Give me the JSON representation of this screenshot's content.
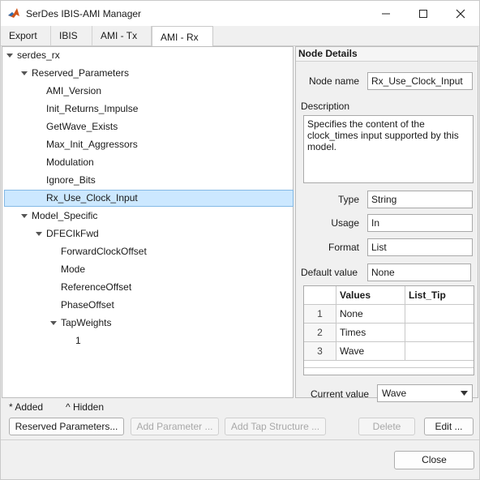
{
  "window": {
    "title": "SerDes IBIS-AMI Manager"
  },
  "tabs": [
    {
      "label": "Export"
    },
    {
      "label": "IBIS"
    },
    {
      "label": "AMI - Tx"
    },
    {
      "label": "AMI - Rx",
      "selected": true
    }
  ],
  "tree": {
    "root": "serdes_rx",
    "reserved": {
      "label": "Reserved_Parameters",
      "items": [
        "AMI_Version",
        "Init_Returns_Impulse",
        "GetWave_Exists",
        "Max_Init_Aggressors",
        "Modulation",
        "Ignore_Bits",
        "Rx_Use_Clock_Input"
      ]
    },
    "model_specific": {
      "label": "Model_Specific",
      "block": "DFECIkFwd",
      "params": [
        "ForwardClockOffset",
        "Mode",
        "ReferenceOffset",
        "PhaseOffset"
      ],
      "tapweights": "TapWeights",
      "tap_child": "1"
    },
    "selected_item": "Rx_Use_Clock_Input"
  },
  "details": {
    "header": "Node Details",
    "node_name_label": "Node name",
    "node_name": "Rx_Use_Clock_Input",
    "description_label": "Description",
    "description": "Specifies the content of the clock_times input supported by this model.",
    "type_label": "Type",
    "type": "String",
    "usage_label": "Usage",
    "usage": "In",
    "format_label": "Format",
    "format": "List",
    "default_label": "Default value",
    "default_value": "None",
    "table": {
      "columns": [
        "Values",
        "List_Tip"
      ],
      "rows": [
        {
          "num": "1",
          "value": "None",
          "tip": ""
        },
        {
          "num": "2",
          "value": "Times",
          "tip": ""
        },
        {
          "num": "3",
          "value": "Wave",
          "tip": ""
        }
      ]
    },
    "current_value_label": "Current value",
    "current_value": "Wave"
  },
  "legend": {
    "added": "* Added",
    "hidden": "^ Hidden"
  },
  "buttons": {
    "reserved_params": "Reserved Parameters...",
    "add_parameter": "Add Parameter ...",
    "add_tap": "Add Tap Structure ...",
    "delete": "Delete",
    "edit": "Edit ...",
    "close": "Close"
  },
  "colors": {
    "selection": "#cce8ff",
    "selection_border": "#84b9e5",
    "window_bg": "#f0f0f0"
  }
}
